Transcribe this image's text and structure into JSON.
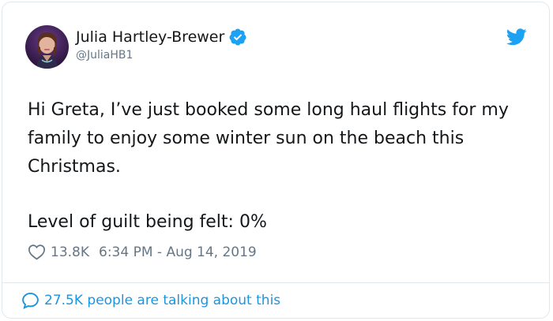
{
  "user": {
    "display_name": "Julia Hartley-Brewer",
    "handle": "@JuliaHB1",
    "verified": true
  },
  "tweet": {
    "lines": [
      "Hi Greta, I’ve just booked some long haul flights for my family to enjoy some winter sun on the beach this Christmas.",
      "Level of guilt being felt: 0%"
    ]
  },
  "meta": {
    "likes": "13.8K",
    "timestamp": "6:34 PM - Aug 14, 2019"
  },
  "footer": {
    "talking": "27.5K people are talking about this"
  },
  "icons": {
    "heart": "heart-icon",
    "verified": "verified-badge-icon",
    "bird": "twitter-bird-icon",
    "bubble": "speech-bubble-icon"
  },
  "colors": {
    "brand": "#1da1f2",
    "link": "#1b95e0",
    "secondary_text": "#657786",
    "border": "#e1e8ed"
  }
}
